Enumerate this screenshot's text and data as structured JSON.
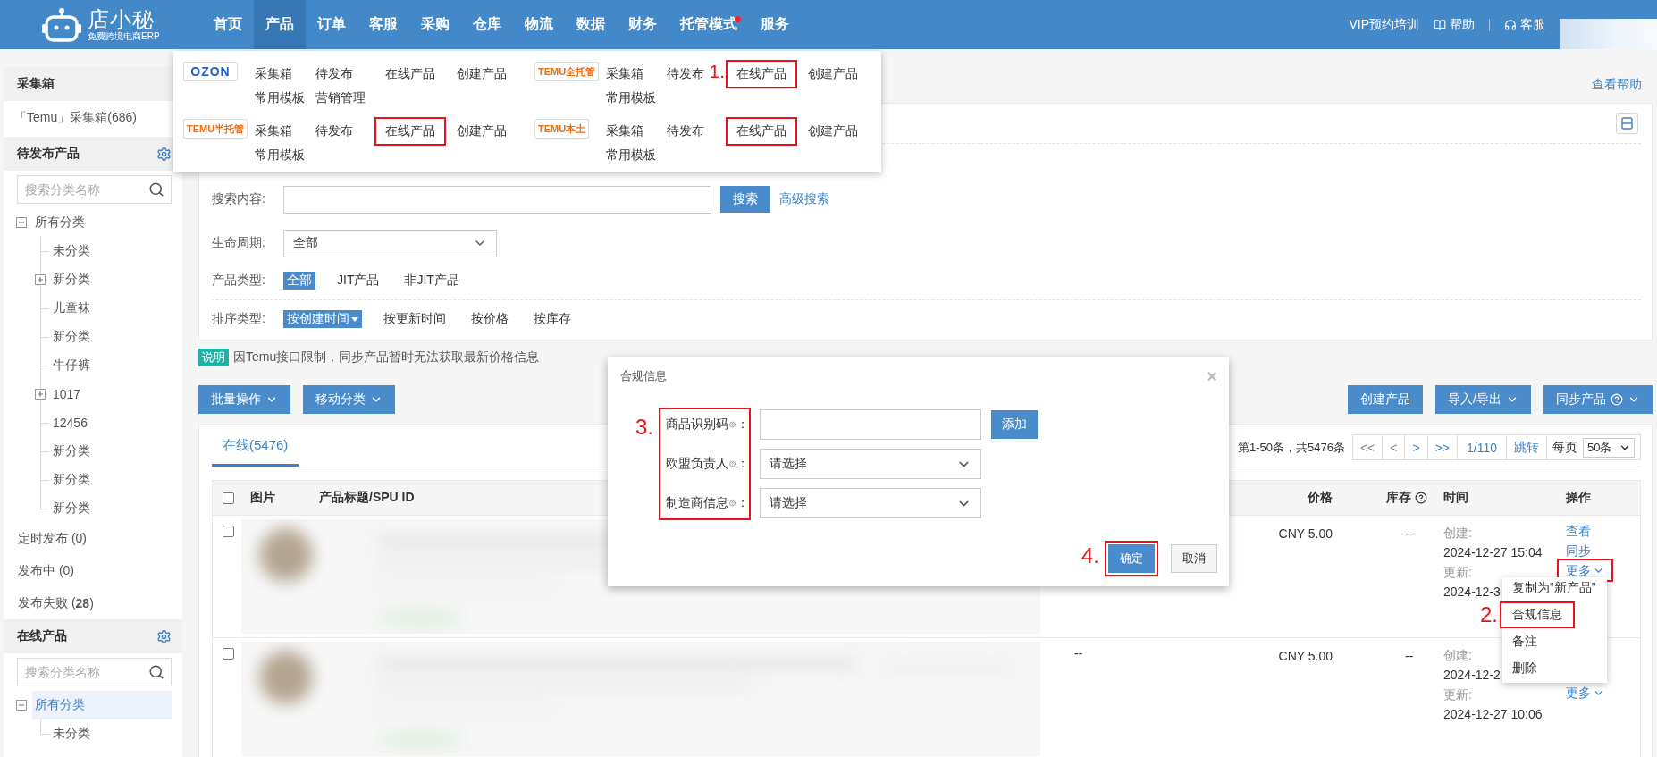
{
  "header": {
    "logo": {
      "name": "店小秘",
      "tagline": "免费跨境电商ERP"
    },
    "nav": [
      {
        "label": "首页",
        "selected": false,
        "dot": false
      },
      {
        "label": "产品",
        "selected": true,
        "dot": false
      },
      {
        "label": "订单",
        "selected": false,
        "dot": false
      },
      {
        "label": "客服",
        "selected": false,
        "dot": false
      },
      {
        "label": "采购",
        "selected": false,
        "dot": false
      },
      {
        "label": "仓库",
        "selected": false,
        "dot": false
      },
      {
        "label": "物流",
        "selected": false,
        "dot": false
      },
      {
        "label": "数据",
        "selected": false,
        "dot": false
      },
      {
        "label": "财务",
        "selected": false,
        "dot": false
      },
      {
        "label": "托管模式",
        "selected": false,
        "dot": true
      },
      {
        "label": "服务",
        "selected": false,
        "dot": false
      }
    ],
    "links": [
      {
        "kind": "plain",
        "label": "VIP预约培训"
      },
      {
        "kind": "book",
        "label": "帮助"
      },
      {
        "kind": "headset",
        "label": "客服"
      }
    ]
  },
  "sidebar": {
    "collect": {
      "title": "采集箱",
      "items": [
        {
          "label": "「Temu」采集箱(686)"
        }
      ]
    },
    "pending": {
      "title": "待发布产品",
      "search": {
        "placeholder": "搜索分类名称"
      },
      "tree": [
        {
          "label": "所有分类",
          "kind": "folder",
          "expanded": true,
          "selected": false,
          "children": [
            {
              "label": "未分类",
              "kind": "leaf",
              "selected": false
            },
            {
              "label": "新分类",
              "kind": "folder",
              "expanded": false,
              "selected": false
            },
            {
              "label": "儿童袜",
              "kind": "leaf",
              "selected": false
            },
            {
              "label": "新分类",
              "kind": "leaf",
              "selected": false
            },
            {
              "label": "牛仔裤",
              "kind": "leaf",
              "selected": false
            },
            {
              "label": "1017",
              "kind": "folder",
              "expanded": false,
              "selected": false
            },
            {
              "label": "12456",
              "kind": "leaf",
              "selected": false
            },
            {
              "label": "新分类",
              "kind": "leaf",
              "selected": false
            },
            {
              "label": "新分类",
              "kind": "leaf",
              "selected": false
            },
            {
              "label": "新分类",
              "kind": "leaf",
              "selected": false
            }
          ]
        }
      ],
      "statuses": [
        {
          "label": "定时发布 (0)"
        },
        {
          "label": "发布中 (0)"
        },
        {
          "label": "发布失败 (**28**)"
        }
      ]
    },
    "online": {
      "title": "在线产品",
      "search": {
        "placeholder": "搜索分类名称"
      },
      "tree": [
        {
          "label": "所有分类",
          "kind": "folder",
          "expanded": true,
          "selected": true,
          "children": [
            {
              "label": "未分类",
              "kind": "leaf",
              "selected": false
            }
          ]
        }
      ]
    }
  },
  "help_link": "查看帮助",
  "filters": {
    "search": {
      "label": "搜索内容:",
      "button": "搜索",
      "advanced": "高级搜索"
    },
    "lifecycle": {
      "label": "生命周期:",
      "value": "全部"
    },
    "product_type": {
      "label": "产品类型:",
      "options": [
        {
          "label": "全部",
          "selected": true
        },
        {
          "label": "JIT产品",
          "selected": false
        },
        {
          "label": "非JIT产品",
          "selected": false
        }
      ]
    },
    "sort": {
      "label": "排序类型:",
      "options": [
        {
          "label": "按创建时间",
          "selected": true
        },
        {
          "label": "按更新时间",
          "selected": false
        },
        {
          "label": "按价格",
          "selected": false
        },
        {
          "label": "按库存",
          "selected": false
        }
      ]
    }
  },
  "notice": {
    "tag": "说明",
    "text": "因Temu接口限制，同步产品暂时无法获取最新价格信息"
  },
  "toolbar": {
    "left": [
      {
        "label": "批量操作",
        "caret": true,
        "help": false
      },
      {
        "label": "移动分类",
        "caret": true,
        "help": false
      }
    ],
    "right": [
      {
        "label": "创建产品",
        "caret": false,
        "help": false
      },
      {
        "label": "导入/导出",
        "caret": true,
        "help": false
      },
      {
        "label": "同步产品",
        "caret": true,
        "help": true
      }
    ]
  },
  "table": {
    "tabs": [
      {
        "label": "在线(5476)",
        "selected": true
      }
    ],
    "pagination": {
      "summary": "第1-50条，共5476条",
      "buttons": [
        {
          "label": "<<",
          "disabled": true
        },
        {
          "label": "<",
          "disabled": true
        },
        {
          "label": ">",
          "disabled": false
        },
        {
          "label": ">>",
          "disabled": false
        }
      ],
      "page": "1/110",
      "jump": "跳转",
      "per_page_label": "每页",
      "per_page": "50条"
    },
    "all_checked": false,
    "columns": [
      {
        "label": "图片",
        "help": false
      },
      {
        "label": "产品标题/SPU ID",
        "help": false
      },
      {
        "label": "价格",
        "help": false
      },
      {
        "label": "库存",
        "help": true
      },
      {
        "label": "时间",
        "help": false
      },
      {
        "label": "操作",
        "help": false
      }
    ],
    "rows": [
      {
        "checked": false,
        "price": "CNY 5.00",
        "stock": "--",
        "created_label": "创建:",
        "created": "2024-12-27 15:04",
        "updated_label": "更新:",
        "updated": "2024-12-3",
        "actions": [
          {
            "label": "查看",
            "more": false,
            "highlighted": false
          },
          {
            "label": "同步",
            "more": false,
            "highlighted": false
          },
          {
            "label": "更多",
            "more": true,
            "highlighted": true
          }
        ]
      },
      {
        "checked": false,
        "column_3": "--",
        "price": "CNY 5.00",
        "stock": "--",
        "created_label": "创建:",
        "created": "2024-12-2",
        "updated_label": "更新:",
        "updated": "2024-12-27 10:06",
        "actions": [
          {
            "label": "更多",
            "more": true,
            "highlighted": false
          }
        ]
      }
    ]
  },
  "product_menu": {
    "platforms": [
      {
        "logo": "OZON",
        "color": "#1f5fd0",
        "items": [
          {
            "label": "采集箱",
            "highlighted": false
          },
          {
            "label": "待发布",
            "highlighted": false
          },
          {
            "label": "在线产品",
            "highlighted": false
          },
          {
            "label": "创建产品",
            "highlighted": false
          },
          {
            "label": "常用模板",
            "highlighted": false
          },
          {
            "label": "营销管理",
            "highlighted": false
          }
        ]
      },
      {
        "logo": "TEMU全托管",
        "color": "#f26a10",
        "items": [
          {
            "label": "采集箱",
            "highlighted": false
          },
          {
            "label": "待发布",
            "highlighted": false
          },
          {
            "label": "在线产品",
            "highlighted": true,
            "step": "1."
          },
          {
            "label": "创建产品",
            "highlighted": false
          },
          {
            "label": "常用模板",
            "highlighted": false
          }
        ]
      },
      {
        "logo": "TEMU半托管",
        "color": "#f26a10",
        "items": [
          {
            "label": "采集箱",
            "highlighted": false
          },
          {
            "label": "待发布",
            "highlighted": false
          },
          {
            "label": "在线产品",
            "highlighted": true
          },
          {
            "label": "创建产品",
            "highlighted": false
          },
          {
            "label": "常用模板",
            "highlighted": false
          }
        ]
      },
      {
        "logo": "TEMU本土",
        "color": "#f26a10",
        "items": [
          {
            "label": "采集箱",
            "highlighted": false
          },
          {
            "label": "待发布",
            "highlighted": false
          },
          {
            "label": "在线产品",
            "highlighted": true
          },
          {
            "label": "创建产品",
            "highlighted": false
          },
          {
            "label": "常用模板",
            "highlighted": false
          }
        ]
      }
    ]
  },
  "modal": {
    "title": "合规信息",
    "close": "×",
    "labels_highlighted": true,
    "labels_step": "3.",
    "fields": [
      {
        "kind": "input",
        "label": "商品识别码",
        "suffix": "：",
        "button": "添加"
      },
      {
        "kind": "select",
        "label": "欧盟负责人",
        "suffix": "：",
        "value": "请选择"
      },
      {
        "kind": "select",
        "label": "制造商信息",
        "suffix": "：",
        "value": "请选择"
      }
    ],
    "buttons": [
      {
        "label": "确定",
        "primary": true,
        "highlighted": true,
        "step": "4."
      },
      {
        "label": "取消",
        "primary": false,
        "highlighted": false
      }
    ]
  },
  "more_menu": {
    "items": [
      {
        "label": "复制为“新产品”",
        "highlighted": false
      },
      {
        "label": "合规信息",
        "highlighted": true,
        "step": "2."
      },
      {
        "label": "备注",
        "highlighted": false
      },
      {
        "label": "删除",
        "highlighted": false
      }
    ]
  }
}
